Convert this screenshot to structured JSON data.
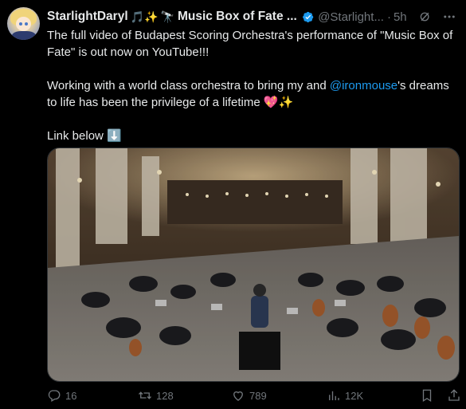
{
  "author": {
    "display_name": "StarlightDaryl",
    "name_suffix": "Music Box of Fate ...",
    "handle": "@Starlight...",
    "time": "5h"
  },
  "tweet": {
    "line1": "The full video of Budapest Scoring Orchestra's performance of \"Music Box of Fate\" is out now on YouTube!!!",
    "line2_pre": "Working with a world class orchestra to bring my and ",
    "mention": "@ironmouse",
    "line2_post": "'s dreams to life has been the privilege of a lifetime 💖✨",
    "line3": "Link below ⬇️"
  },
  "actions": {
    "replies": "16",
    "reposts": "128",
    "likes": "789",
    "views": "12K"
  },
  "colors": {
    "background": "#000000",
    "text": "#e7e9ea",
    "muted": "#71767b",
    "accent": "#1d9bf0"
  }
}
